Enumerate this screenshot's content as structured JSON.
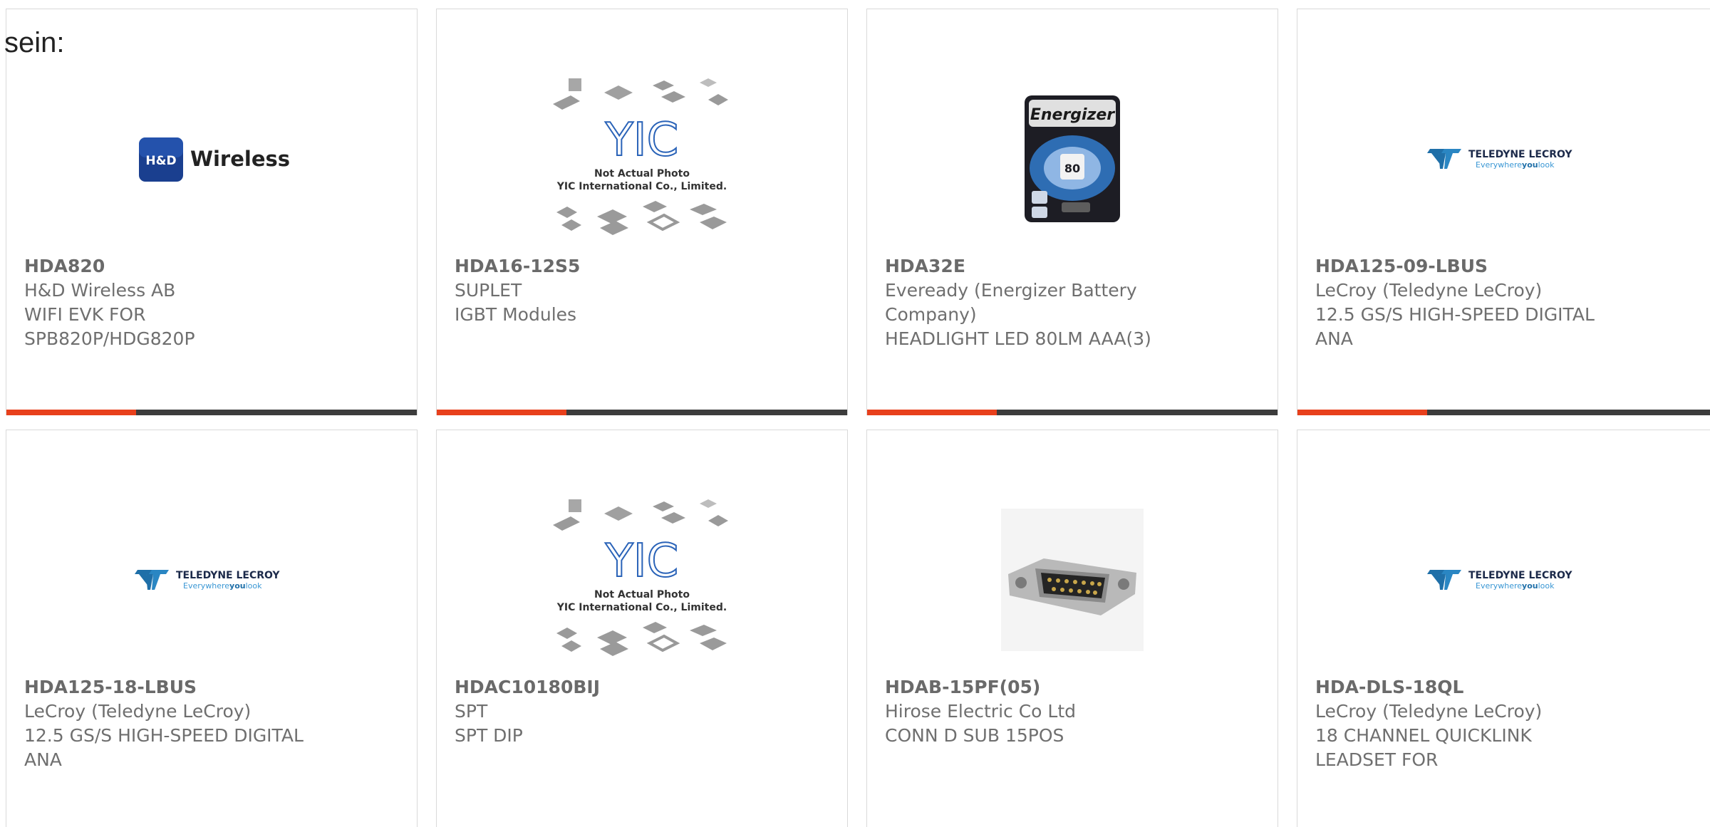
{
  "page": {
    "intro_text": "sein:",
    "accent_color": "#e8401c"
  },
  "products": [
    {
      "part": "HDA820",
      "manufacturer": "H&D Wireless AB",
      "desc1": "WIFI EVK FOR",
      "desc2": "SPB820P/HDG820P",
      "image": "hd-wireless-logo"
    },
    {
      "part": "HDA16-12S5",
      "manufacturer": "SUPLET",
      "desc1": "IGBT Modules",
      "desc2": "",
      "image": "yic-placeholder"
    },
    {
      "part": "HDA32E",
      "manufacturer": "Eveready (Energizer Battery",
      "desc1": "Company)",
      "desc2": "HEADLIGHT LED 80LM AAA(3)",
      "image": "energizer-headlight"
    },
    {
      "part": "HDA125-09-LBUS",
      "manufacturer": "LeCroy (Teledyne LeCroy)",
      "desc1": "12.5 GS/S HIGH-SPEED DIGITAL",
      "desc2": "ANA",
      "image": "teledyne-logo"
    },
    {
      "part": "HDA125-18-LBUS",
      "manufacturer": "LeCroy (Teledyne LeCroy)",
      "desc1": "12.5 GS/S HIGH-SPEED DIGITAL",
      "desc2": "ANA",
      "image": "teledyne-logo"
    },
    {
      "part": "HDAC10180BIJ",
      "manufacturer": "SPT",
      "desc1": "SPT DIP",
      "desc2": "",
      "image": "yic-placeholder"
    },
    {
      "part": "HDAB-15PF(05)",
      "manufacturer": "Hirose Electric Co Ltd",
      "desc1": "CONN D SUB 15POS",
      "desc2": "",
      "image": "dsub-connector"
    },
    {
      "part": "HDA-DLS-18QL",
      "manufacturer": "LeCroy (Teledyne LeCroy)",
      "desc1": "18 CHANNEL QUICKLINK",
      "desc2": "LEADSET FOR",
      "image": "teledyne-logo"
    }
  ],
  "logos": {
    "hd_badge": "H&D",
    "hd_text": "Wireless",
    "teledyne_name": "TELEDYNE LECROY",
    "teledyne_tag_a": "Everywhere",
    "teledyne_tag_b": "you",
    "teledyne_tag_c": "look",
    "yic_mark": "YIC",
    "yic_line1": "Not Actual Photo",
    "yic_line2": "YIC International Co., Limited.",
    "energizer_brand": "Energizer",
    "energizer_lumens": "80"
  }
}
